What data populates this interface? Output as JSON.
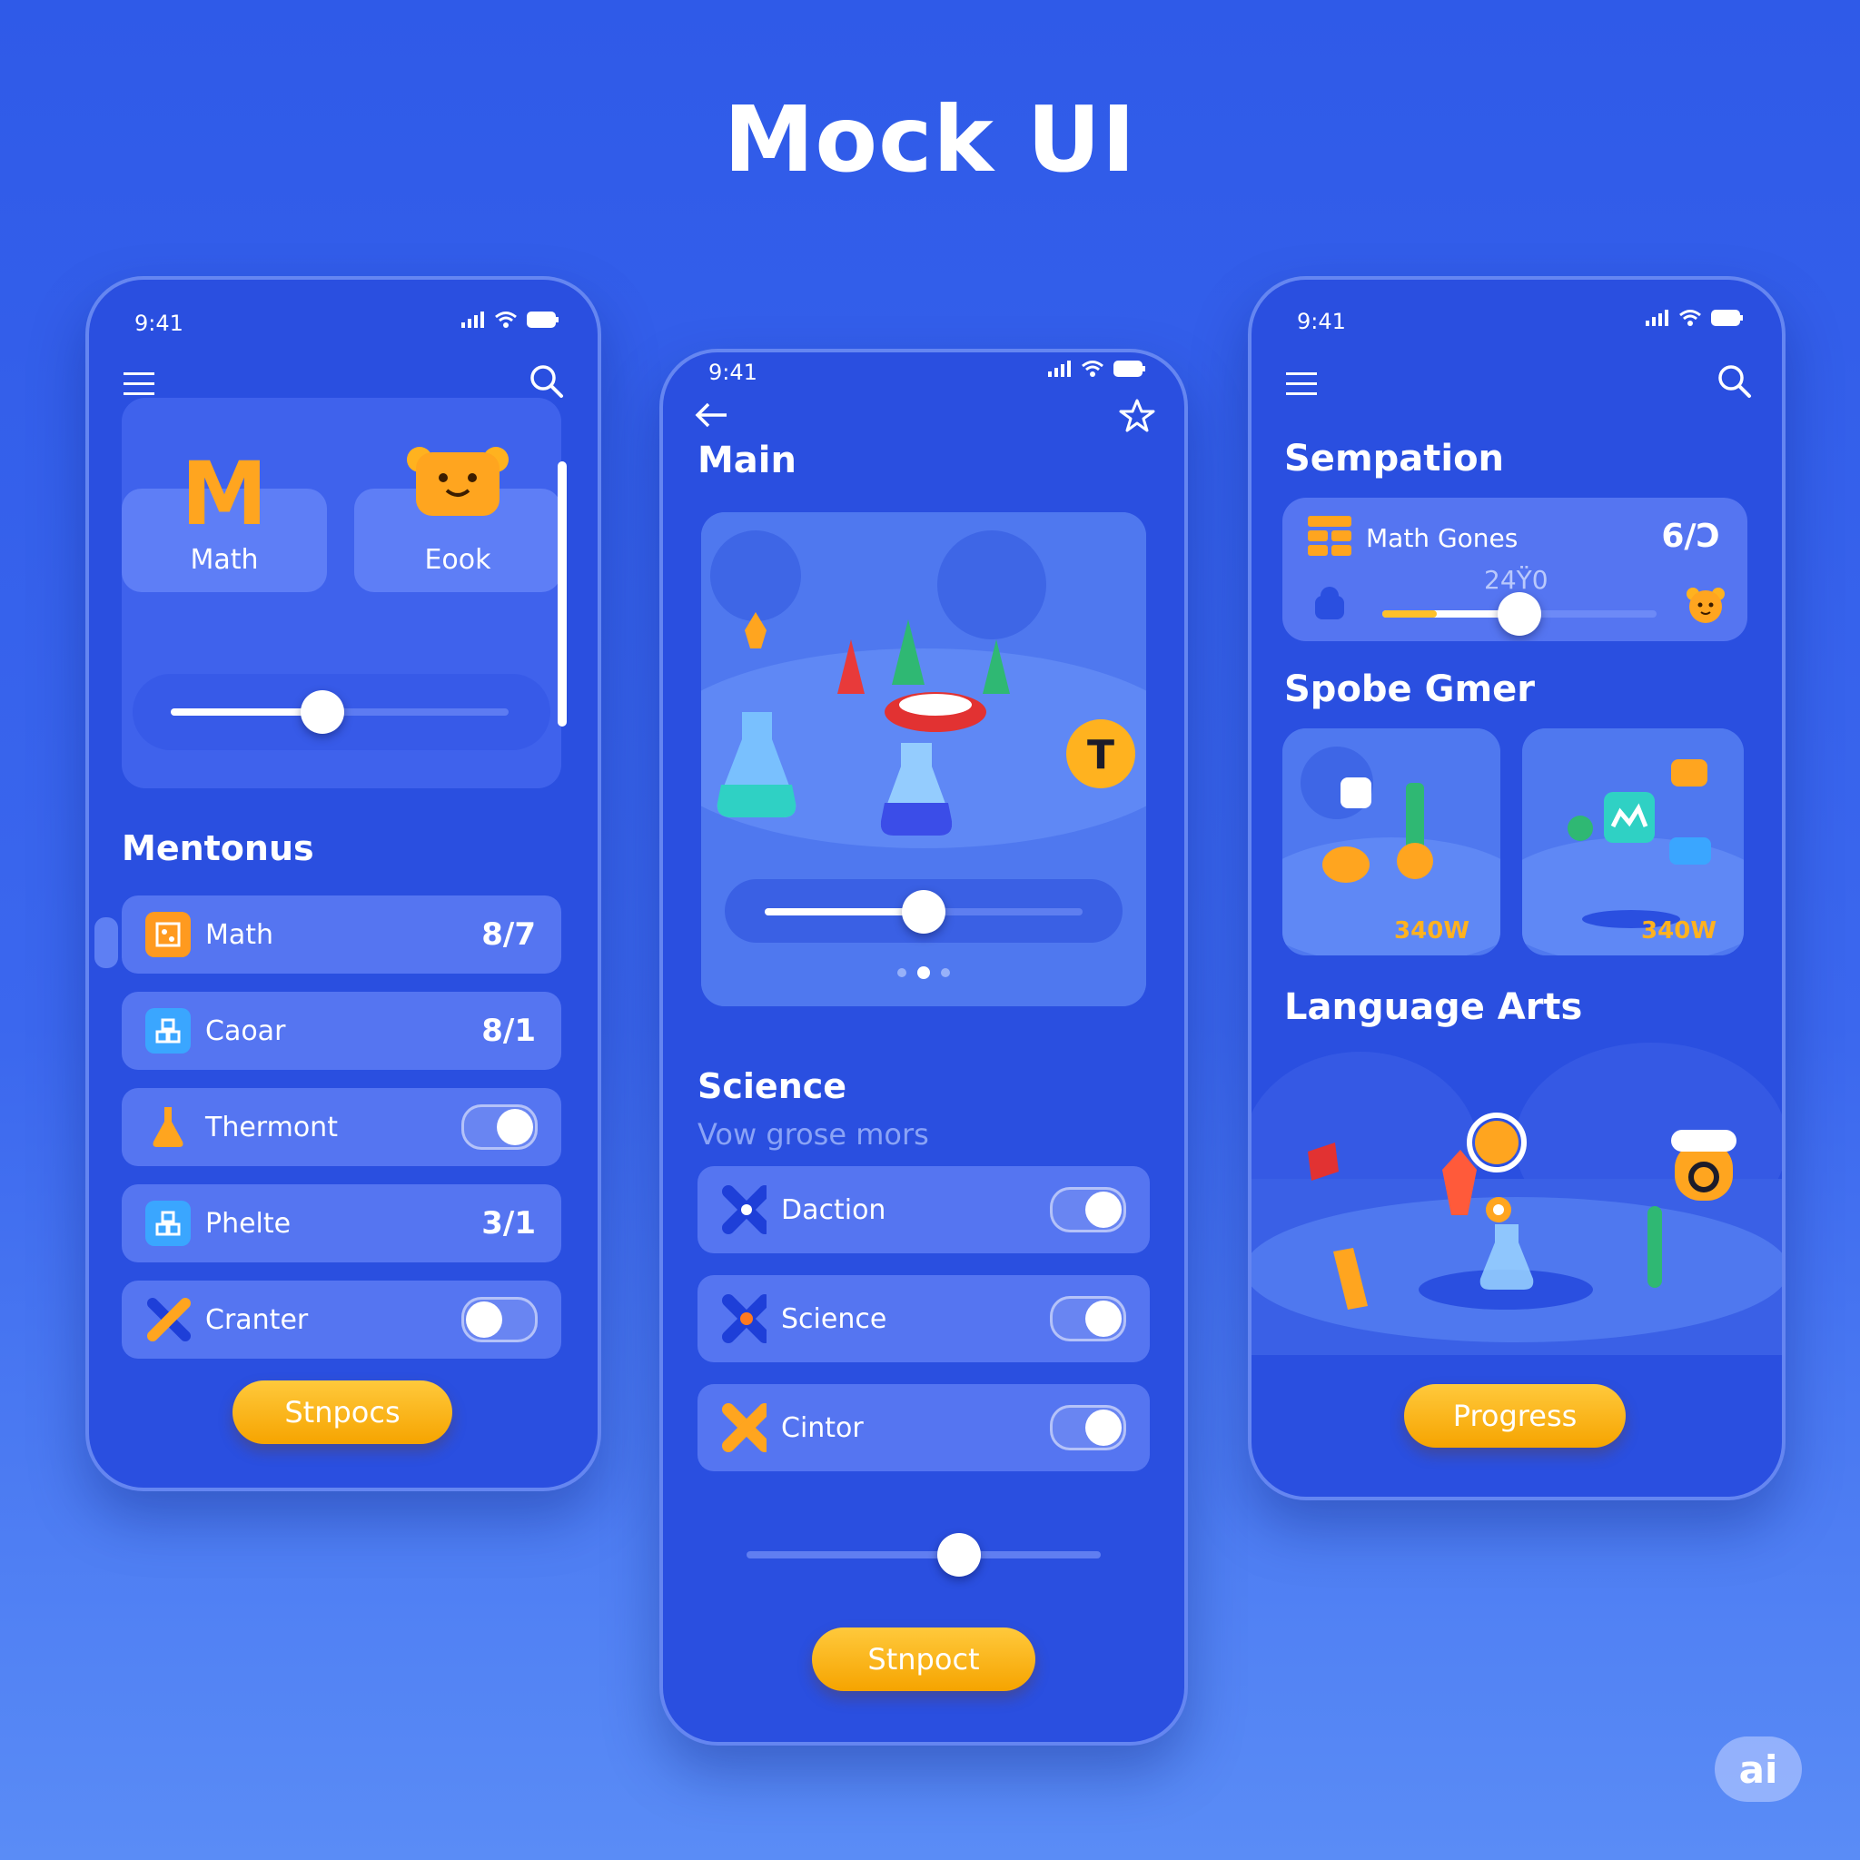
{
  "headline": "Mock UI",
  "phone1": {
    "status_time": "9:41",
    "tiles": [
      {
        "label": "Math",
        "glyph": "M",
        "icon": "letter-m-icon"
      },
      {
        "label": "Eook",
        "icon": "bear-face-icon"
      }
    ],
    "hero_slider_level": 0.45,
    "section_title": "Mentonus",
    "rows": [
      {
        "label": "Math",
        "value": "8/7",
        "icon": "abacus-icon"
      },
      {
        "label": "Caoar",
        "value": "8/1",
        "icon": "blocks-icon"
      },
      {
        "label": "Thermont",
        "toggle": "on",
        "icon": "flask-icon"
      },
      {
        "label": "Phelte",
        "value": "3/1",
        "icon": "blocks-icon"
      },
      {
        "label": "Cranter",
        "toggle": "off",
        "icon": "cross-icon"
      }
    ],
    "cta": "Stnpocs"
  },
  "phone2": {
    "status_time": "9:41",
    "title": "Main",
    "media_slider_level": 0.5,
    "badge_letter": "T",
    "carousel_active": 2,
    "section_title": "Science",
    "section_subtitle": "Vow grose mors",
    "rows": [
      {
        "label": "Daction",
        "toggle": "on",
        "icon": "cross-icon"
      },
      {
        "label": "Science",
        "toggle": "on",
        "icon": "cross-icon"
      },
      {
        "label": "Cintor",
        "toggle": "on",
        "icon": "cross-icon"
      }
    ],
    "bottom_slider_level": 0.6,
    "cta": "Stnpoct"
  },
  "phone3": {
    "status_time": "9:41",
    "section1_title": "Sempation",
    "progress_card": {
      "label": "Math Gones",
      "value": "6/Ɔ",
      "sub_value": "24Ÿ0",
      "slider_level": 0.5,
      "slider_accent_level": 0.2
    },
    "section2_title": "Spobe Gmer",
    "game_cards": [
      {
        "label": "340W"
      },
      {
        "label": "340W"
      }
    ],
    "section3_title": "Language Arts",
    "cta": "Progress"
  },
  "watermark": "ai",
  "colors": {
    "background": "#2f5ae8",
    "card": "#7896ff",
    "accent": "#f6a400",
    "track_fill": "#ffffff",
    "progress_accent": "#ffc02a"
  }
}
